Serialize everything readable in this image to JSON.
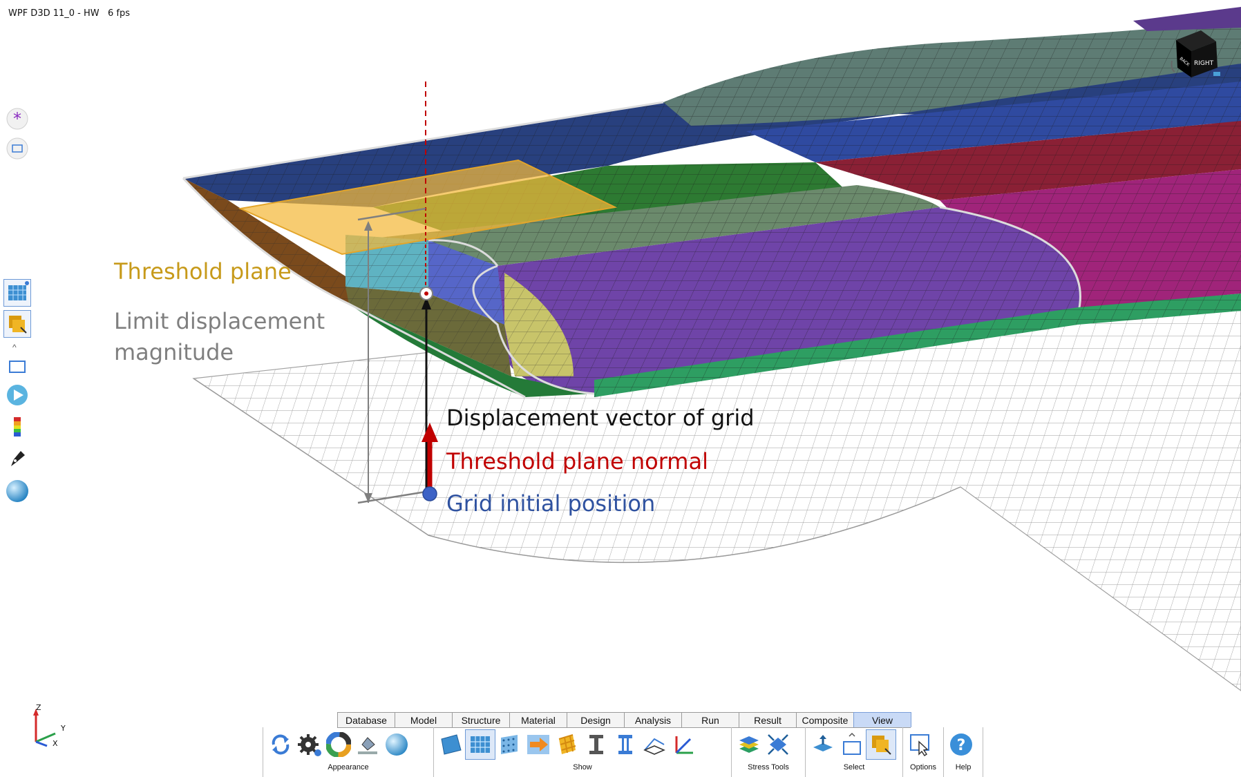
{
  "window": {
    "title": "WPF D3D 11_0 - HW",
    "fps": "6 fps"
  },
  "view_cube": {
    "face_right": "RIGHT",
    "face_back": "BACK"
  },
  "annotations": {
    "threshold_plane": "Threshold plane",
    "limit_line1": "Limit displacement",
    "limit_line2": "magnitude",
    "displacement_vector": "Displacement vector of grid",
    "threshold_normal": "Threshold plane normal",
    "grid_initial": "Grid initial position"
  },
  "colors": {
    "threshold_plane": "#c79a1a",
    "limit": "#7f7f7f",
    "displacement": "#111111",
    "normal": "#c00000",
    "grid": "#2f52a0"
  },
  "side_toolbar": [
    {
      "name": "selection-asterisk-icon"
    },
    {
      "name": "frame-icon"
    },
    {
      "name": "mesh-display-icon"
    },
    {
      "name": "select-surface-icon"
    },
    {
      "name": "frame-outline-icon"
    },
    {
      "name": "play-icon"
    },
    {
      "name": "color-legend-icon"
    },
    {
      "name": "pen-icon"
    },
    {
      "name": "sphere-icon"
    }
  ],
  "axis_triad": {
    "z": "Z",
    "y": "Y",
    "x": "X"
  },
  "ribbon": {
    "tabs": [
      "Database",
      "Model",
      "Structure",
      "Material",
      "Design",
      "Analysis",
      "Run",
      "Result",
      "Composite",
      "View"
    ],
    "active_tab": "View",
    "groups": {
      "appearance": "Appearance",
      "show": "Show",
      "stress_tools": "Stress Tools",
      "select": "Select",
      "options": "Options",
      "help": "Help"
    }
  }
}
